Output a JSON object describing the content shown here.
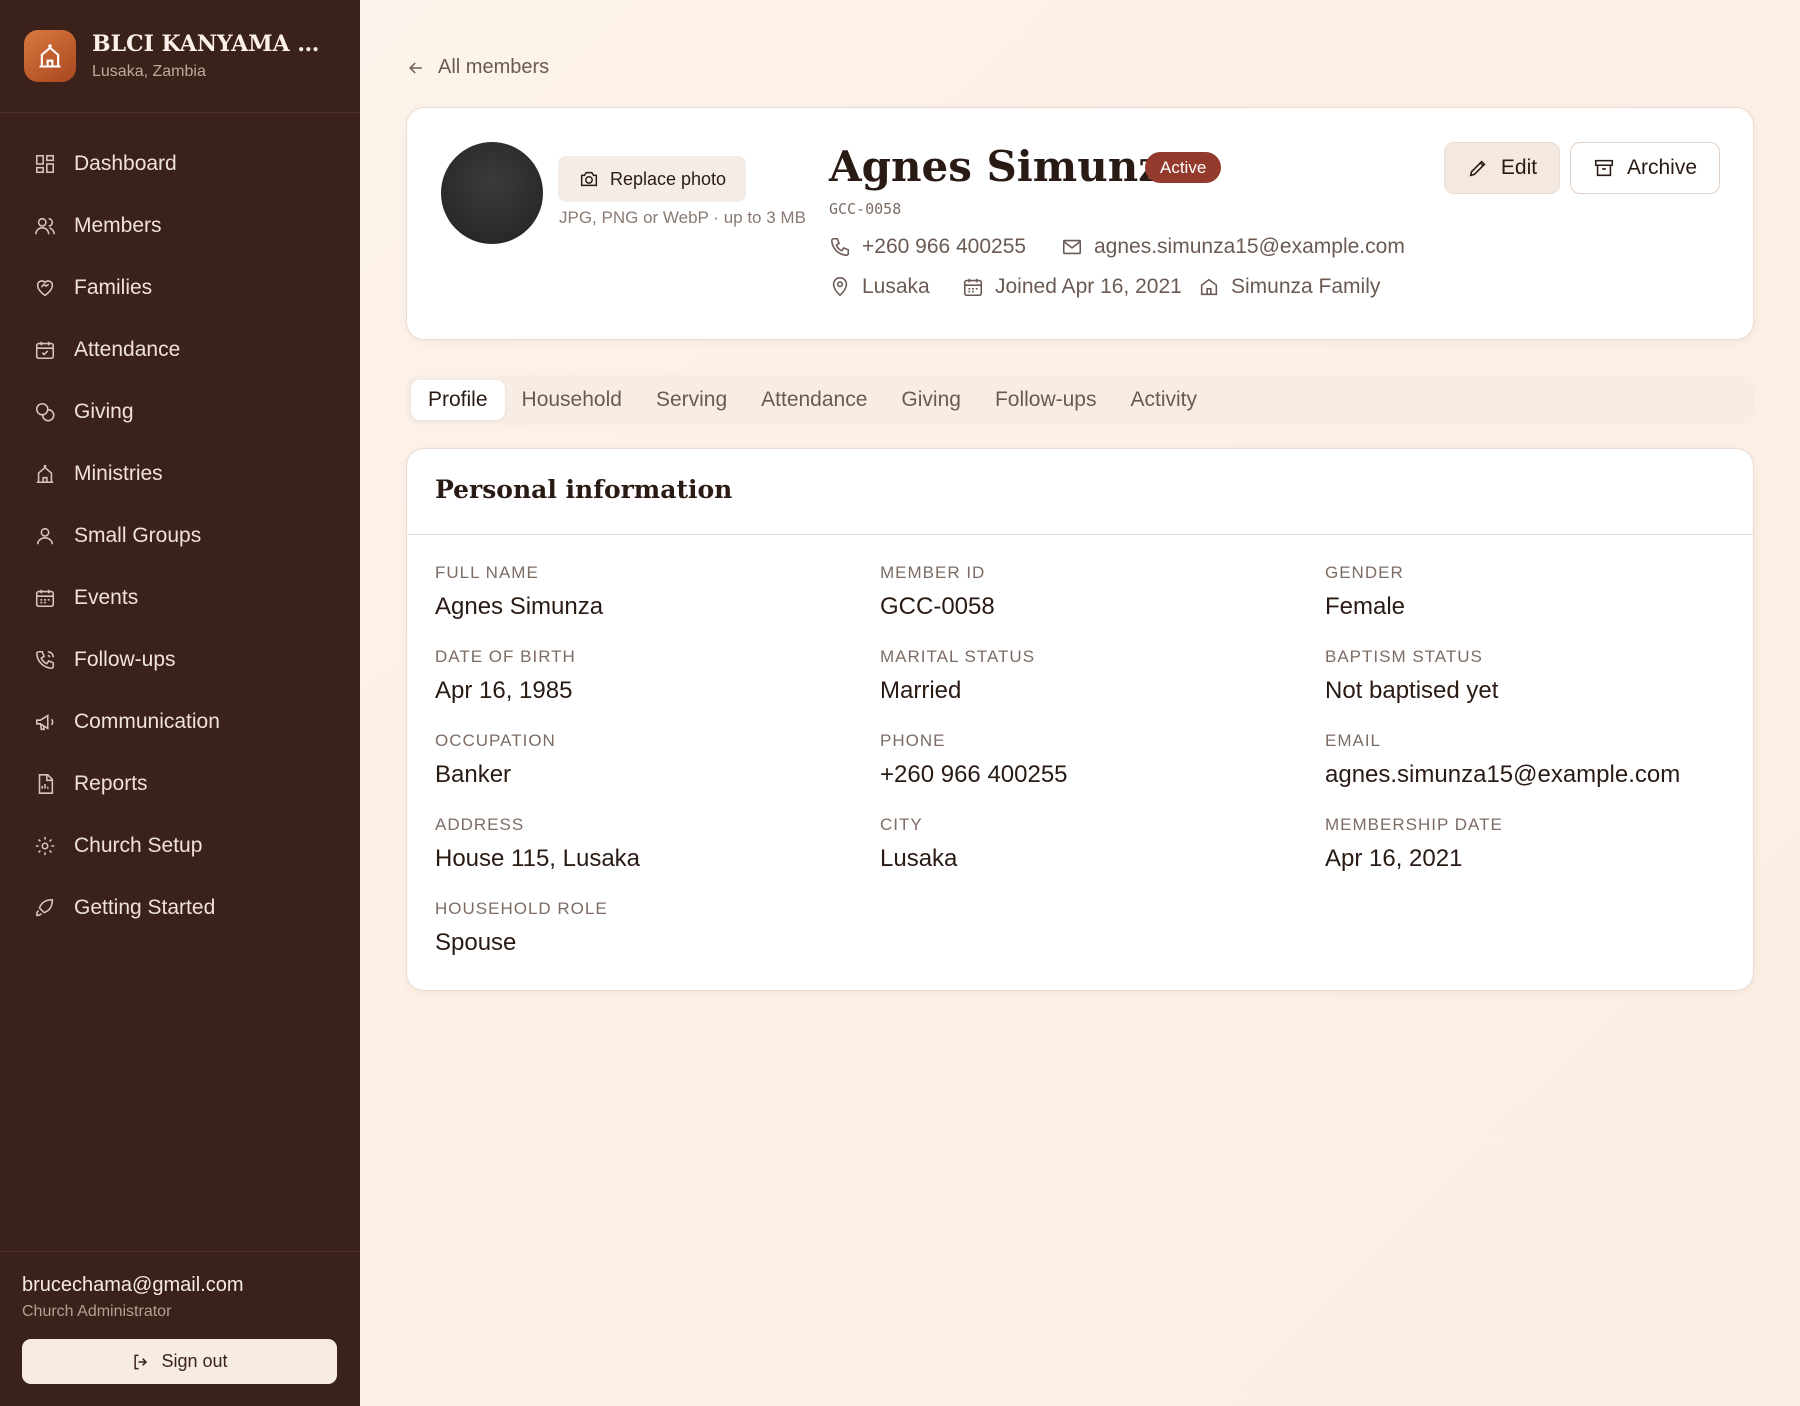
{
  "sidebar": {
    "church_name": "BLCI KANYAMA BR...",
    "church_location": "Lusaka, Zambia",
    "nav": [
      {
        "label": "Dashboard",
        "icon": "dashboard-icon"
      },
      {
        "label": "Members",
        "icon": "users-icon"
      },
      {
        "label": "Families",
        "icon": "heart-handshake-icon"
      },
      {
        "label": "Attendance",
        "icon": "calendar-check-icon"
      },
      {
        "label": "Giving",
        "icon": "coins-icon"
      },
      {
        "label": "Ministries",
        "icon": "church-icon"
      },
      {
        "label": "Small Groups",
        "icon": "user-group-icon"
      },
      {
        "label": "Events",
        "icon": "calendar-icon"
      },
      {
        "label": "Follow-ups",
        "icon": "phone-call-icon"
      },
      {
        "label": "Communication",
        "icon": "megaphone-icon"
      },
      {
        "label": "Reports",
        "icon": "report-icon"
      },
      {
        "label": "Church Setup",
        "icon": "gear-icon"
      },
      {
        "label": "Getting Started",
        "icon": "rocket-icon"
      }
    ],
    "user_email": "brucechama@gmail.com",
    "user_role": "Church Administrator",
    "sign_out_label": "Sign out"
  },
  "main": {
    "back_label": "All members",
    "header": {
      "replace_photo_label": "Replace photo",
      "photo_hint": "JPG, PNG or WebP · up to 3 MB",
      "name": "Agnes Simunza",
      "status": "Active",
      "member_code": "GCC-0058",
      "phone": "+260 966 400255",
      "email": "agnes.simunza15@example.com",
      "city": "Lusaka",
      "joined": "Joined Apr 16, 2021",
      "family": "Simunza Family",
      "edit_label": "Edit",
      "archive_label": "Archive"
    },
    "tabs": [
      "Profile",
      "Household",
      "Serving",
      "Attendance",
      "Giving",
      "Follow-ups",
      "Activity"
    ],
    "active_tab": "Profile",
    "personal_info": {
      "title": "Personal information",
      "fields": [
        {
          "label": "FULL NAME",
          "value": "Agnes Simunza"
        },
        {
          "label": "MEMBER ID",
          "value": "GCC-0058"
        },
        {
          "label": "GENDER",
          "value": "Female"
        },
        {
          "label": "DATE OF BIRTH",
          "value": "Apr 16, 1985"
        },
        {
          "label": "MARITAL STATUS",
          "value": "Married"
        },
        {
          "label": "BAPTISM STATUS",
          "value": "Not baptised yet"
        },
        {
          "label": "OCCUPATION",
          "value": "Banker"
        },
        {
          "label": "PHONE",
          "value": "+260 966 400255"
        },
        {
          "label": "EMAIL",
          "value": "agnes.simunza15@example.com"
        },
        {
          "label": "ADDRESS",
          "value": "House 115, Lusaka"
        },
        {
          "label": "CITY",
          "value": "Lusaka"
        },
        {
          "label": "MEMBERSHIP DATE",
          "value": "Apr 16, 2021"
        },
        {
          "label": "HOUSEHOLD ROLE",
          "value": "Spouse"
        }
      ]
    }
  },
  "colors": {
    "sidebar_bg": "#3a211a",
    "accent": "#933a2c",
    "page_bg": "#fcf5ee"
  }
}
